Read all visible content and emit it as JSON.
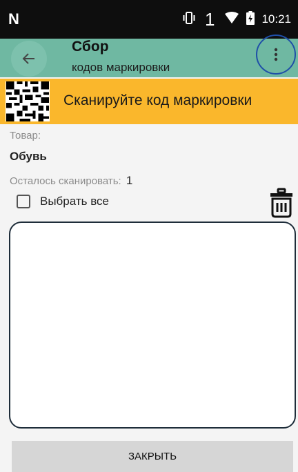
{
  "status_bar": {
    "sim_slot": "1",
    "time": "10:21",
    "icons": [
      "n-logo-icon",
      "vibrate-icon",
      "wifi-icon",
      "battery-icon"
    ]
  },
  "app_bar": {
    "title": "Сбор",
    "subtitle": "кодов маркировки",
    "background": "#6fb8a2",
    "icons": [
      "arrow-back-icon",
      "more-vert-icon"
    ]
  },
  "scan_banner": {
    "text": "Сканируйте код маркировки",
    "background": "#fab72c",
    "icon": "qr-code-icon"
  },
  "product": {
    "label": "Товар:",
    "value": "Обувь"
  },
  "remaining": {
    "label": "Осталось сканировать:",
    "count": "1"
  },
  "select_all": {
    "label": "Выбрать все",
    "checked": false
  },
  "delete_icon": "trash-icon",
  "scanned_codes": [],
  "footer": {
    "close_label": "ЗАКРЫТЬ"
  }
}
